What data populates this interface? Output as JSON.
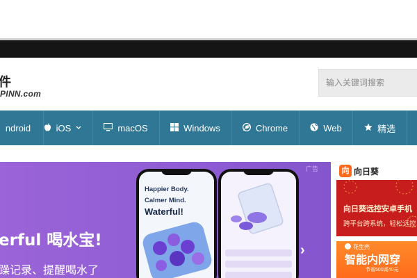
{
  "header": {
    "logo_main": "件",
    "logo_sub": "PINN.com",
    "search": {
      "placeholder": "输入关键词搜索"
    }
  },
  "nav": {
    "items": [
      {
        "label": "ndroid",
        "icon": "android-icon"
      },
      {
        "label": "iOS",
        "icon": "apple-icon",
        "has_dropdown": true
      },
      {
        "label": "macOS",
        "icon": "monitor-icon"
      },
      {
        "label": "Windows",
        "icon": "windows-icon"
      },
      {
        "label": "Chrome",
        "icon": "chrome-icon"
      },
      {
        "label": "Web",
        "icon": "globe-icon"
      },
      {
        "label": "精选",
        "icon": "star-icon"
      }
    ]
  },
  "banner": {
    "ad_label": "广告",
    "title": "erful 喝水宝!",
    "subtitle": "躁记录、提醒喝水了",
    "next_arrow": "›",
    "phone": {
      "line1": "Happier Body.",
      "line2": "Calmer Mind.",
      "line3": "Waterful!"
    }
  },
  "side_ads": [
    {
      "logo_char": "向",
      "brand": "向日葵",
      "title": "向日葵远控安卓手机",
      "subtitle": "跨平台跨系统，轻松远控"
    },
    {
      "brand": "花生壳",
      "title": "智能内网穿",
      "subtitle": "节省500减40元"
    }
  ],
  "colors": {
    "nav_bg": "#2f7794",
    "banner_bg": "#9b64d8",
    "side_ad_red": "#c81d1d",
    "side_ad_orange": "#ff7a22"
  }
}
